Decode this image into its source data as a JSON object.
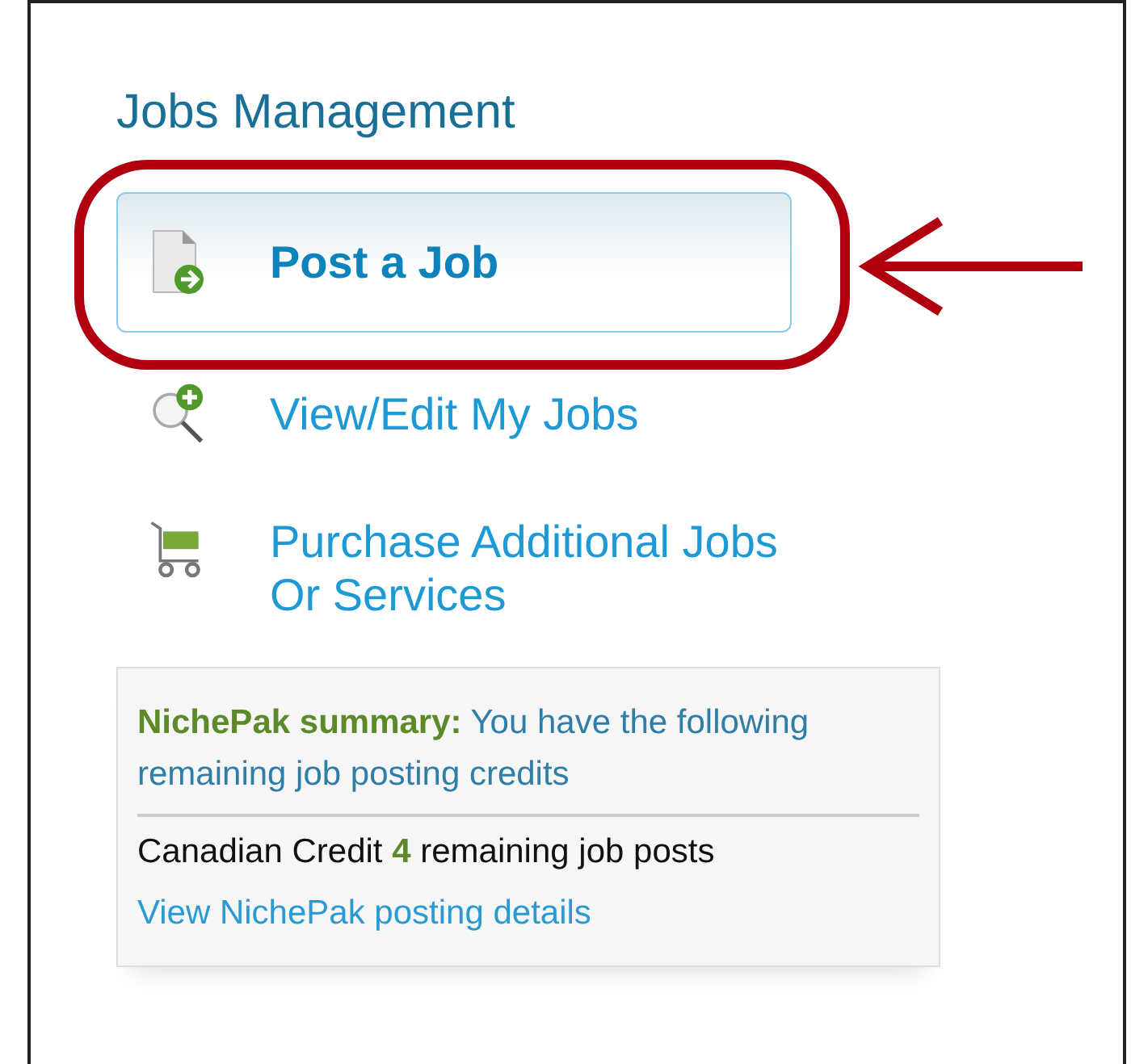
{
  "section_title": "Jobs Management",
  "menu": [
    {
      "label": "Post a Job",
      "kind": "post",
      "selected": true
    },
    {
      "label": "View/Edit My Jobs",
      "kind": "view",
      "selected": false
    },
    {
      "label": "Purchase Additional Jobs Or Services",
      "kind": "purchase",
      "selected": false
    }
  ],
  "summary": {
    "intro": "**NichePak summary:** You have the following remaining job posting credits",
    "credit": "Canadian Credit **4** remaining job posts",
    "link": "View NichePak posting details"
  }
}
